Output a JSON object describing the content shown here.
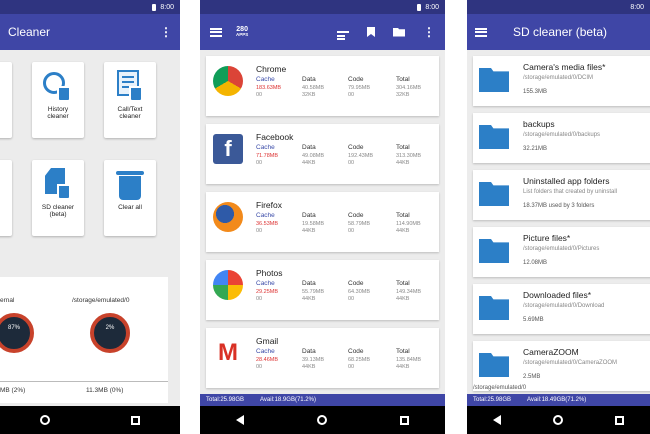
{
  "status_time": "8:00",
  "screen1": {
    "title": "Cleaner",
    "tiles": [
      {
        "label_lines": [
          "History",
          "cleaner"
        ],
        "icon": "history-clean-icon"
      },
      {
        "label_lines": [
          "Call/Text",
          "cleaner"
        ],
        "icon": "calltext-clean-icon"
      },
      {
        "label_lines": [
          "SD cleaner",
          "(beta)"
        ],
        "icon": "sd-clean-icon"
      },
      {
        "label_lines": [
          "Clear all",
          ""
        ],
        "icon": "trash-icon"
      }
    ],
    "storage_label_left": "ernal",
    "storage_label_right": "/storage/emulated/0",
    "gauge_left_pct": "87%",
    "gauge_right_pct": "2%",
    "usage_left": "MB (2%)",
    "usage_right": "11.3MB (0%)"
  },
  "screen2": {
    "logo_top": "280",
    "logo_bottom": "APPS",
    "columns": [
      "Cache",
      "Data",
      "Code",
      "Total"
    ],
    "apps": [
      {
        "name": "Chrome",
        "icon": "chrome-icon",
        "cache": [
          "183.63MB",
          "00"
        ],
        "data": [
          "40.58MB",
          "32KB"
        ],
        "code": [
          "79.95MB",
          "00"
        ],
        "total": [
          "304.16MB",
          "32KB"
        ]
      },
      {
        "name": "Facebook",
        "icon": "facebook-icon",
        "cache": [
          "71.78MB",
          "00"
        ],
        "data": [
          "49.08MB",
          "44KB"
        ],
        "code": [
          "192.43MB",
          "00"
        ],
        "total": [
          "313.30MB",
          "44KB"
        ]
      },
      {
        "name": "Firefox",
        "icon": "firefox-icon",
        "cache": [
          "36.53MB",
          "00"
        ],
        "data": [
          "19.58MB",
          "44KB"
        ],
        "code": [
          "58.79MB",
          "00"
        ],
        "total": [
          "114.90MB",
          "44KB"
        ]
      },
      {
        "name": "Photos",
        "icon": "photos-icon",
        "cache": [
          "29.25MB",
          "00"
        ],
        "data": [
          "55.79MB",
          "44KB"
        ],
        "code": [
          "64.30MB",
          "00"
        ],
        "total": [
          "149.34MB",
          "44KB"
        ]
      },
      {
        "name": "Gmail",
        "icon": "gmail-icon",
        "cache": [
          "28.46MB",
          "00"
        ],
        "data": [
          "39.13MB",
          "44KB"
        ],
        "code": [
          "68.25MB",
          "00"
        ],
        "total": [
          "135.84MB",
          "44KB"
        ]
      }
    ],
    "total_text": "Total:25.98GB",
    "avail_text": "Avail:18.9GB(71.2%)"
  },
  "screen3": {
    "title": "SD cleaner (beta)",
    "folders": [
      {
        "title": "Camera's media files*",
        "path": "/storage/emulated/0/DCIM",
        "size": "155.3MB"
      },
      {
        "title": "backups",
        "path": "/storage/emulated/0/backups",
        "size": "32.21MB"
      },
      {
        "title": "Uninstalled app folders",
        "path": "List folders that created by uninstall",
        "size": "18.37MB used by 3 folders"
      },
      {
        "title": "Picture files*",
        "path": "/storage/emulated/0/Pictures",
        "size": "12.08MB"
      },
      {
        "title": "Downloaded files*",
        "path": "/storage/emulated/0/Download",
        "size": "5.69MB"
      },
      {
        "title": "CameraZOOM",
        "path": "/storage/emulated/0/CameraZOOM",
        "size": "2.5MB"
      }
    ],
    "footer_path": "/storage/emulated/0",
    "total_text": "Total:25.98GB",
    "avail_text": "Avail:18.49GB(71.2%)"
  },
  "colors": {
    "appbar": "#3f46a6",
    "statusbar": "#2f3480",
    "icon_blue": "#2c7fc7",
    "cache_red": "#dd3333"
  }
}
